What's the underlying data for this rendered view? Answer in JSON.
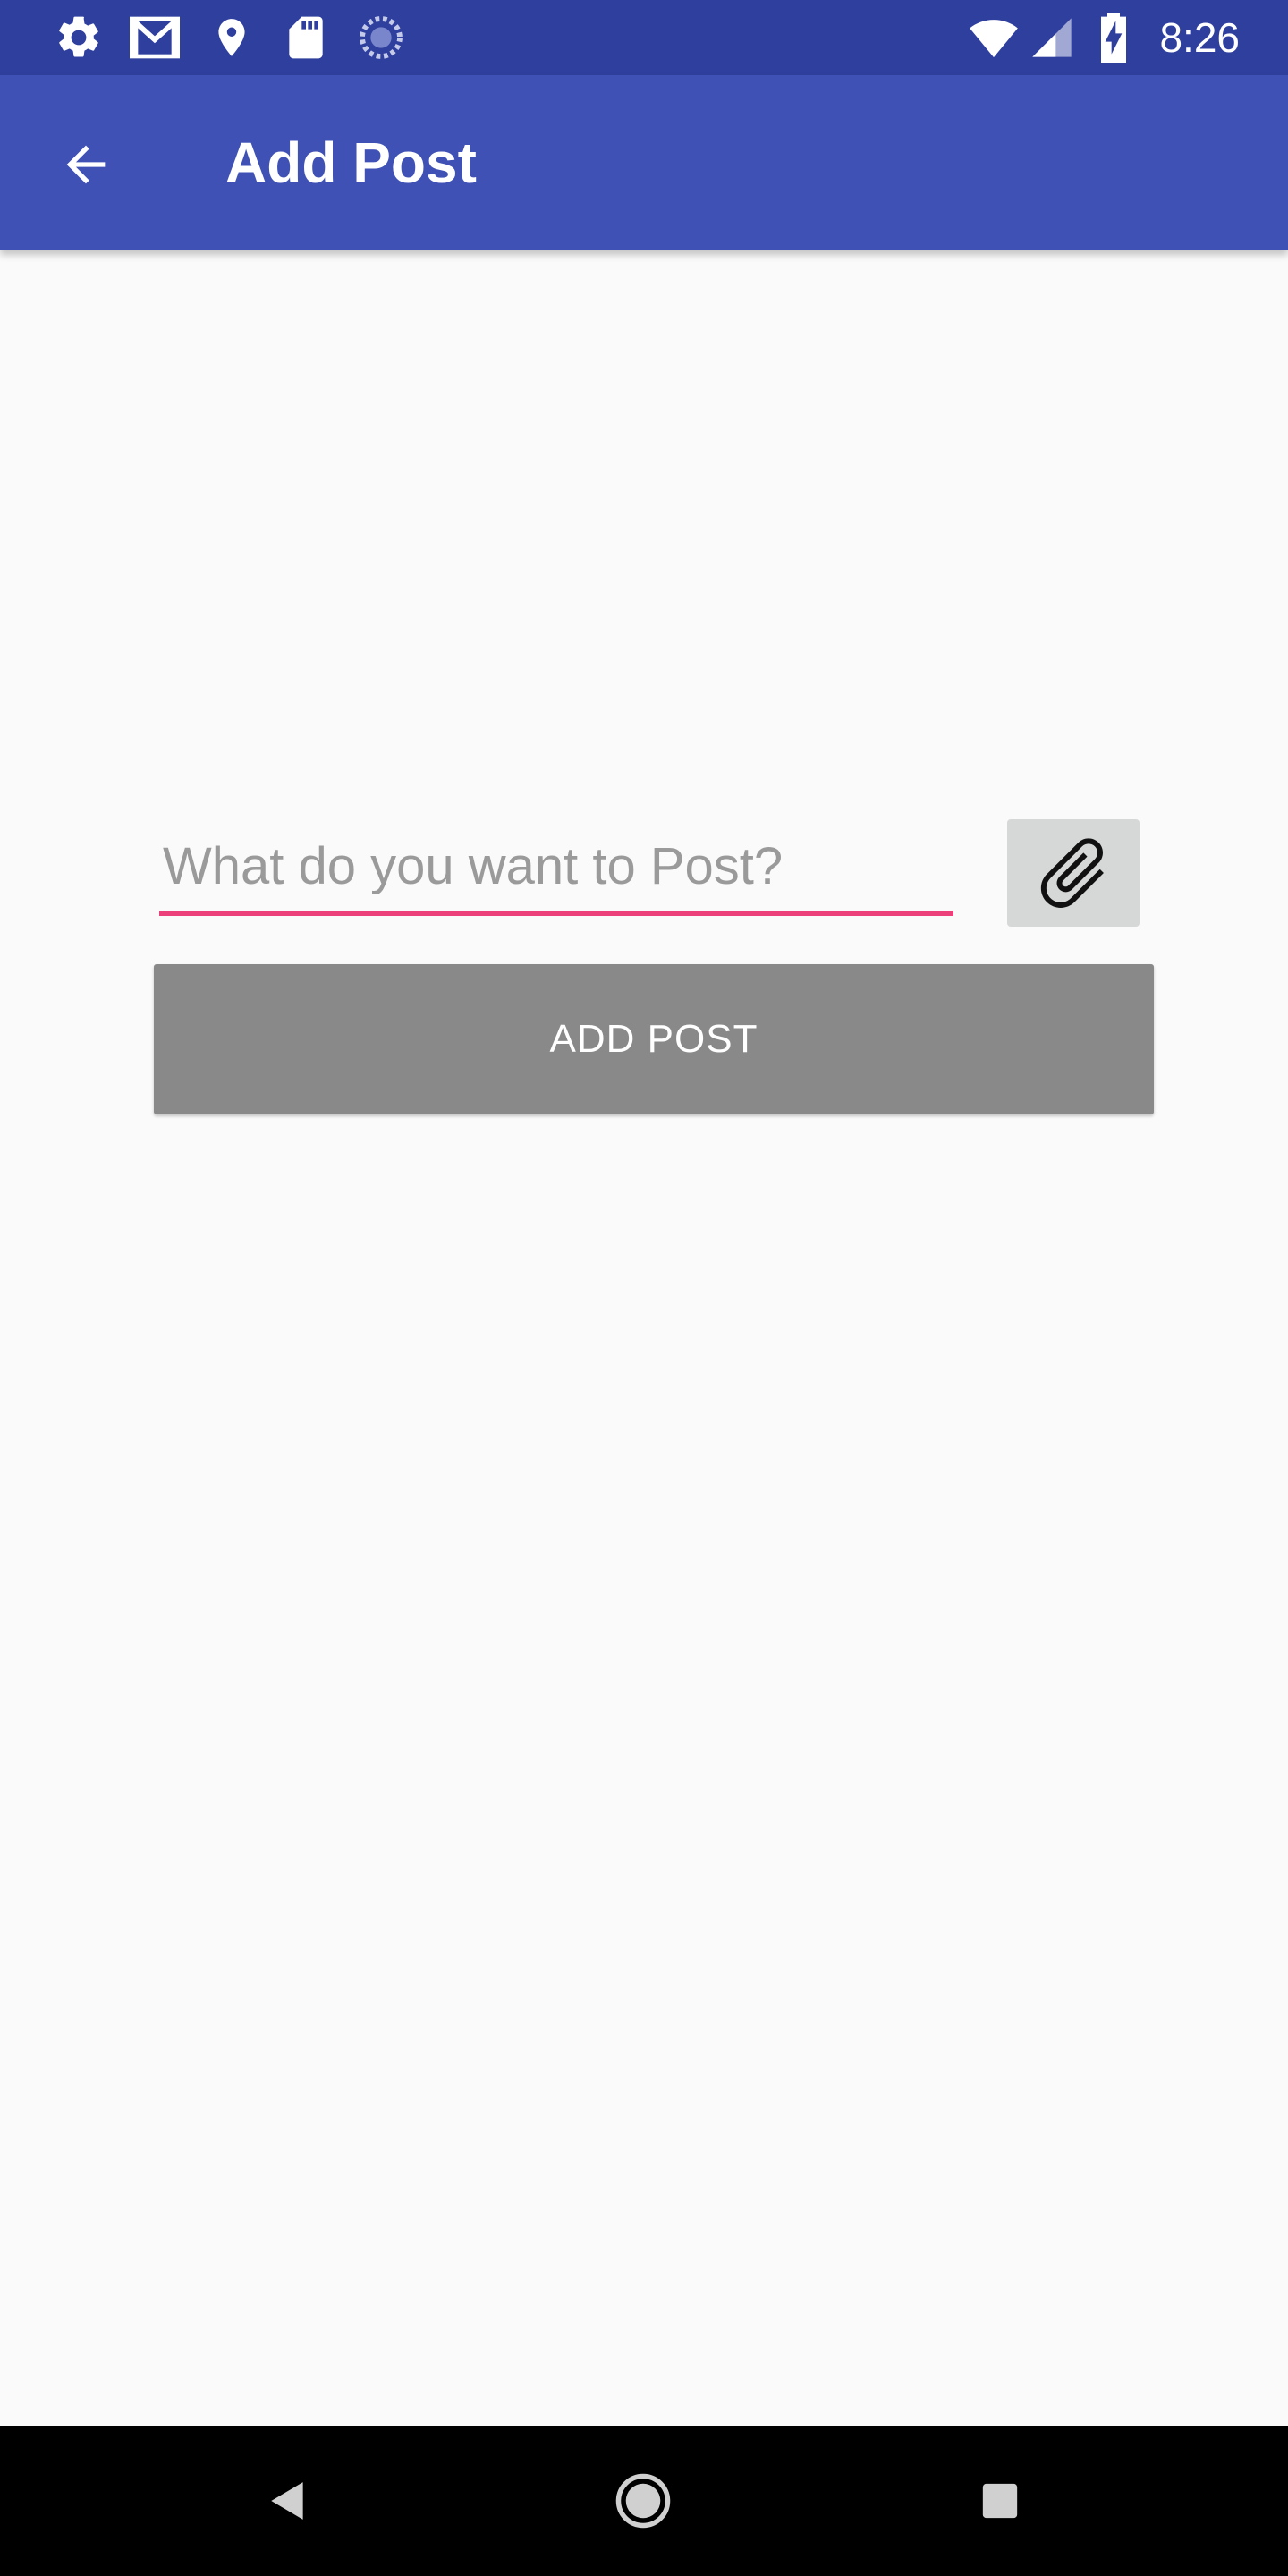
{
  "status_bar": {
    "time": "8:26",
    "left_icons": [
      "settings-icon",
      "gmail-icon",
      "location-icon",
      "sd-card-icon",
      "sync-icon"
    ],
    "right_icons": [
      "wifi-icon",
      "signal-icon",
      "battery-charging-icon"
    ]
  },
  "app_bar": {
    "title": "Add Post",
    "back_icon": "arrow-back-icon"
  },
  "form": {
    "post_input": {
      "value": "",
      "placeholder": "What do you want to Post?"
    },
    "attach_icon": "paperclip-icon",
    "add_post_label": "ADD POST"
  },
  "nav_bar": {
    "buttons": [
      "back-triangle-icon",
      "home-circle-icon",
      "recents-square-icon"
    ]
  },
  "colors": {
    "status_bar": "#2f3f9e",
    "app_bar": "#3f51b5",
    "accent": "#ec407a",
    "button_disabled": "#898989",
    "attach_button": "#d6d7d7",
    "background": "#fafafa"
  }
}
